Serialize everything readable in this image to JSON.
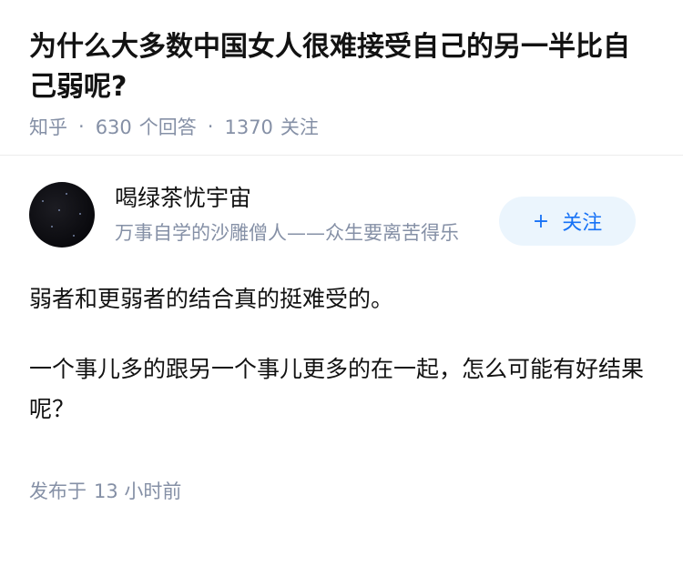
{
  "question": {
    "title": "为什么大多数中国女人很难接受自己的另一半比自己弱呢?",
    "source": "知乎",
    "separator": "·",
    "answers_count": "630",
    "answers_label": "个回答",
    "followers_count": "1370",
    "followers_label": "关注"
  },
  "answer": {
    "author": {
      "name": "喝绿茶忧宇宙",
      "bio": "万事自学的沙雕僧人——众生要离苦得乐",
      "follow_plus": "+",
      "follow_label": "关注"
    },
    "paragraphs": [
      "弱者和更弱者的结合真的挺难受的。",
      "一个事儿多的跟另一个事儿更多的在一起，怎么可能有好结果呢？"
    ],
    "published_label": "发布于",
    "published_time": "13 小时前"
  },
  "colors": {
    "meta_gray": "#8590a6",
    "brand_blue": "#1772f6",
    "follow_bg": "#ebf5fd"
  }
}
